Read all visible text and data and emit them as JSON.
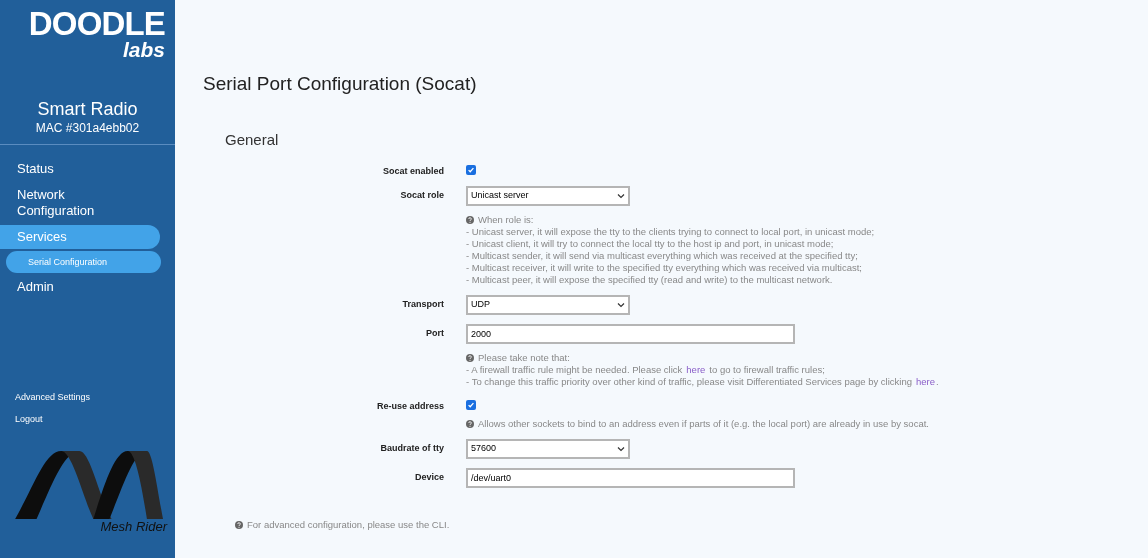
{
  "sidebar": {
    "logo": {
      "word": "DOODLE",
      "sub": "labs"
    },
    "device": {
      "name": "Smart Radio",
      "mac": "MAC #301a4ebb02"
    },
    "nav": [
      {
        "label": "Status",
        "selected": false
      },
      {
        "label": "Network Configuration",
        "selected": false
      },
      {
        "label": "Services",
        "selected": true,
        "children": [
          {
            "label": "Serial Configuration",
            "selected": true
          }
        ]
      },
      {
        "label": "Admin",
        "selected": false
      }
    ],
    "links": [
      "Advanced Settings",
      "Logout"
    ],
    "brand": "Mesh Rider"
  },
  "page": {
    "title": "Serial Port Configuration (Socat)",
    "section": "General",
    "fields": [
      {
        "kind": "checkbox",
        "label": "Socat enabled",
        "checked": true
      },
      {
        "kind": "select",
        "label": "Socat role",
        "value": "Unicast server",
        "help": [
          {
            "text": "When role is:"
          },
          {
            "text": "- Unicast server, it will expose the tty to the clients trying to connect to local port, in unicast mode;"
          },
          {
            "text": "- Unicast client, it will try to connect the local tty to the host ip and port, in unicast mode;"
          },
          {
            "text": "- Multicast sender, it will send via multicast everything which was received at the specified tty;"
          },
          {
            "text": "- Multicast receiver, it will write to the specified tty everything which was received via multicast;"
          },
          {
            "text": "- Multicast peer, it will expose the specified tty (read and write) to the multicast network."
          }
        ]
      },
      {
        "kind": "select",
        "label": "Transport",
        "value": "UDP"
      },
      {
        "kind": "text",
        "label": "Port",
        "value": "2000",
        "help": [
          {
            "text": "Please take note that:"
          },
          {
            "text": "- A firewall traffic rule might be needed. Please click",
            "link": "here",
            "after": "to go to firewall traffic rules;"
          },
          {
            "text": "- To change this traffic priority over other kind of traffic, please visit Differentiated Services page by clicking",
            "link": "here",
            "after": "."
          }
        ]
      },
      {
        "kind": "checkbox",
        "label": "Re-use address",
        "checked": true,
        "help": [
          {
            "text": "Allows other sockets to bind to an address even if parts of it (e.g. the local port) are already in use by socat."
          }
        ]
      },
      {
        "kind": "select",
        "label": "Baudrate of tty",
        "value": "57600"
      },
      {
        "kind": "text",
        "label": "Device",
        "value": "/dev/uart0"
      }
    ],
    "footer_note": "For advanced configuration, please use the CLI."
  }
}
